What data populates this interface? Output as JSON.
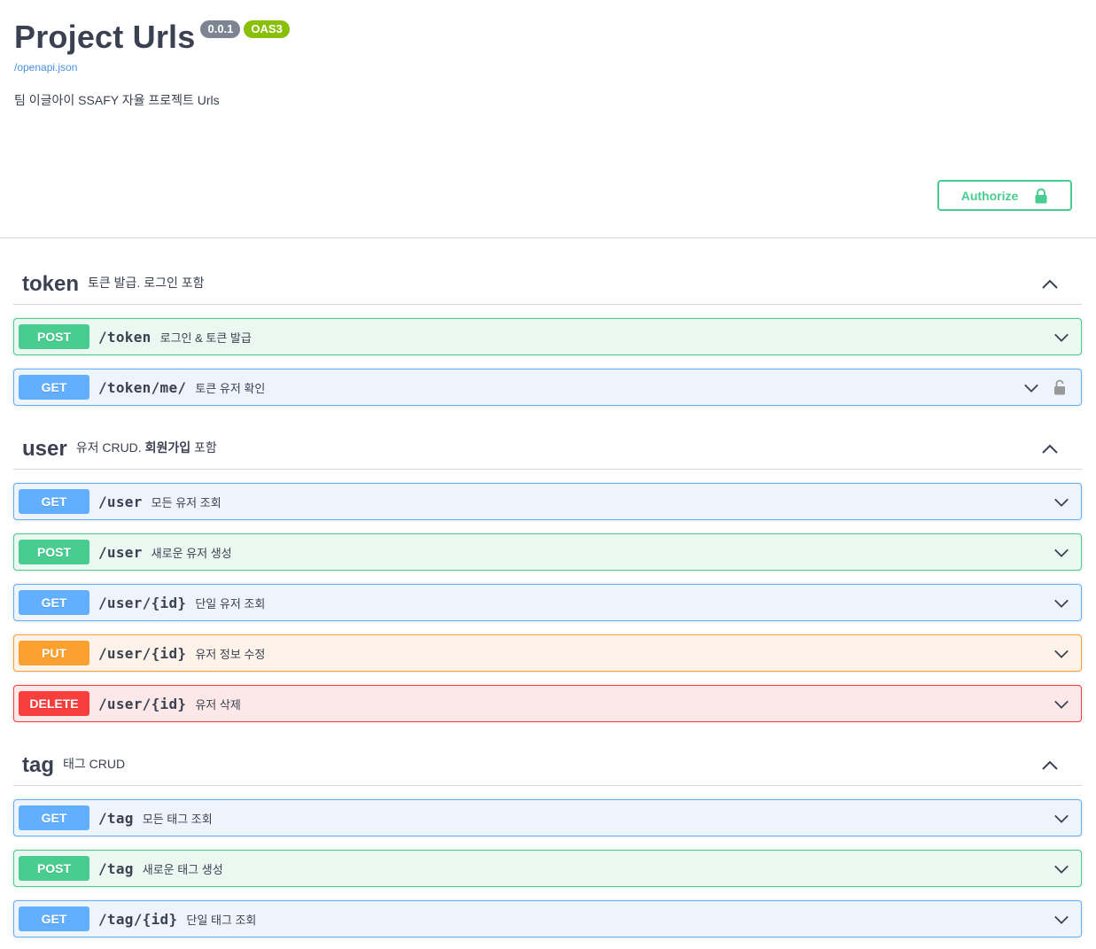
{
  "info": {
    "title": "Project Urls",
    "version": "0.0.1",
    "oas": "OAS3",
    "spec_link": "/openapi.json",
    "description": "팀 이글아이 SSAFY 자율 프로젝트 Urls"
  },
  "authorize": {
    "label": "Authorize"
  },
  "colors": {
    "get": "#61affe",
    "post": "#49cc90",
    "put": "#fca130",
    "delete": "#f93e3e",
    "text": "#3b4151"
  },
  "tags": [
    {
      "name": "token",
      "description": "토큰 발급. 로그인 포함",
      "operations": [
        {
          "method": "POST",
          "path": "/token",
          "summary": "로그인 & 토큰 발급"
        },
        {
          "method": "GET",
          "path": "/token/me/",
          "summary": "토큰 유저 확인"
        }
      ]
    },
    {
      "name": "user",
      "description_prefix": "유저 CRUD.",
      "description_bold": "회원가입",
      "description_suffix": "포함",
      "operations": [
        {
          "method": "GET",
          "path": "/user",
          "summary": "모든 유저 조회"
        },
        {
          "method": "POST",
          "path": "/user",
          "summary": "새로운 유저 생성"
        },
        {
          "method": "GET",
          "path": "/user/{id}",
          "summary": "단일 유저 조회"
        },
        {
          "method": "PUT",
          "path": "/user/{id}",
          "summary": "유저 정보 수정"
        },
        {
          "method": "DELETE",
          "path": "/user/{id}",
          "summary": "유저 삭제"
        }
      ]
    },
    {
      "name": "tag",
      "description": "태그 CRUD",
      "operations": [
        {
          "method": "GET",
          "path": "/tag",
          "summary": "모든 태그 조회"
        },
        {
          "method": "POST",
          "path": "/tag",
          "summary": "새로운 태그 생성"
        },
        {
          "method": "GET",
          "path": "/tag/{id}",
          "summary": "단일 태그 조회"
        }
      ]
    }
  ]
}
